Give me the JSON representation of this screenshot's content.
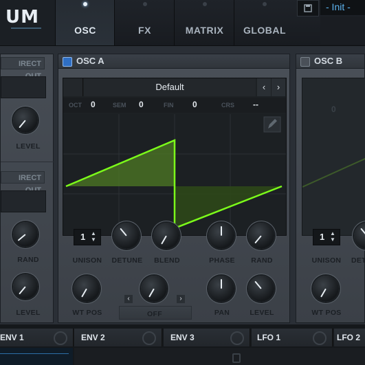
{
  "app": {
    "logo_text": "UM"
  },
  "tabs": [
    {
      "label": "OSC",
      "active": true
    },
    {
      "label": "FX",
      "active": false
    },
    {
      "label": "MATRIX",
      "active": false
    },
    {
      "label": "GLOBAL",
      "active": false
    }
  ],
  "preset": {
    "save_icon": "save-icon",
    "name": "- Init -"
  },
  "left_partial": {
    "direct_out_1": "IRECT OUT",
    "direct_out_2": "IRECT OUT",
    "level_1": "LEVEL",
    "rand": "RAND",
    "level_2": "LEVEL"
  },
  "osc_a": {
    "title": "OSC  A",
    "wavetable_name": "Default",
    "params": {
      "oct_label": "OCT",
      "oct": "0",
      "sem_label": "SEM",
      "sem": "0",
      "fin_label": "FIN",
      "fin": "0",
      "crs_label": "CRS",
      "crs": "--"
    },
    "unison_value": "1",
    "labels": {
      "unison": "UNISON",
      "detune": "DETUNE",
      "blend": "BLEND",
      "phase": "PHASE",
      "rand": "RAND",
      "wt_pos": "WT POS",
      "off": "OFF",
      "pan": "PAN",
      "level": "LEVEL"
    },
    "colors": {
      "wave": "#7cfc1a",
      "check": "#2f6fc4"
    }
  },
  "osc_b": {
    "title": "OSC  B",
    "unison_value": "1",
    "labels": {
      "unison": "UNISON",
      "detune": "DET",
      "wt_pos": "WT POS"
    },
    "param_value": "0"
  },
  "bottom_tabs": [
    {
      "label": "ENV 1"
    },
    {
      "label": "ENV 2"
    },
    {
      "label": "ENV 3"
    },
    {
      "label": "LFO 1"
    },
    {
      "label": "LFO 2"
    }
  ]
}
